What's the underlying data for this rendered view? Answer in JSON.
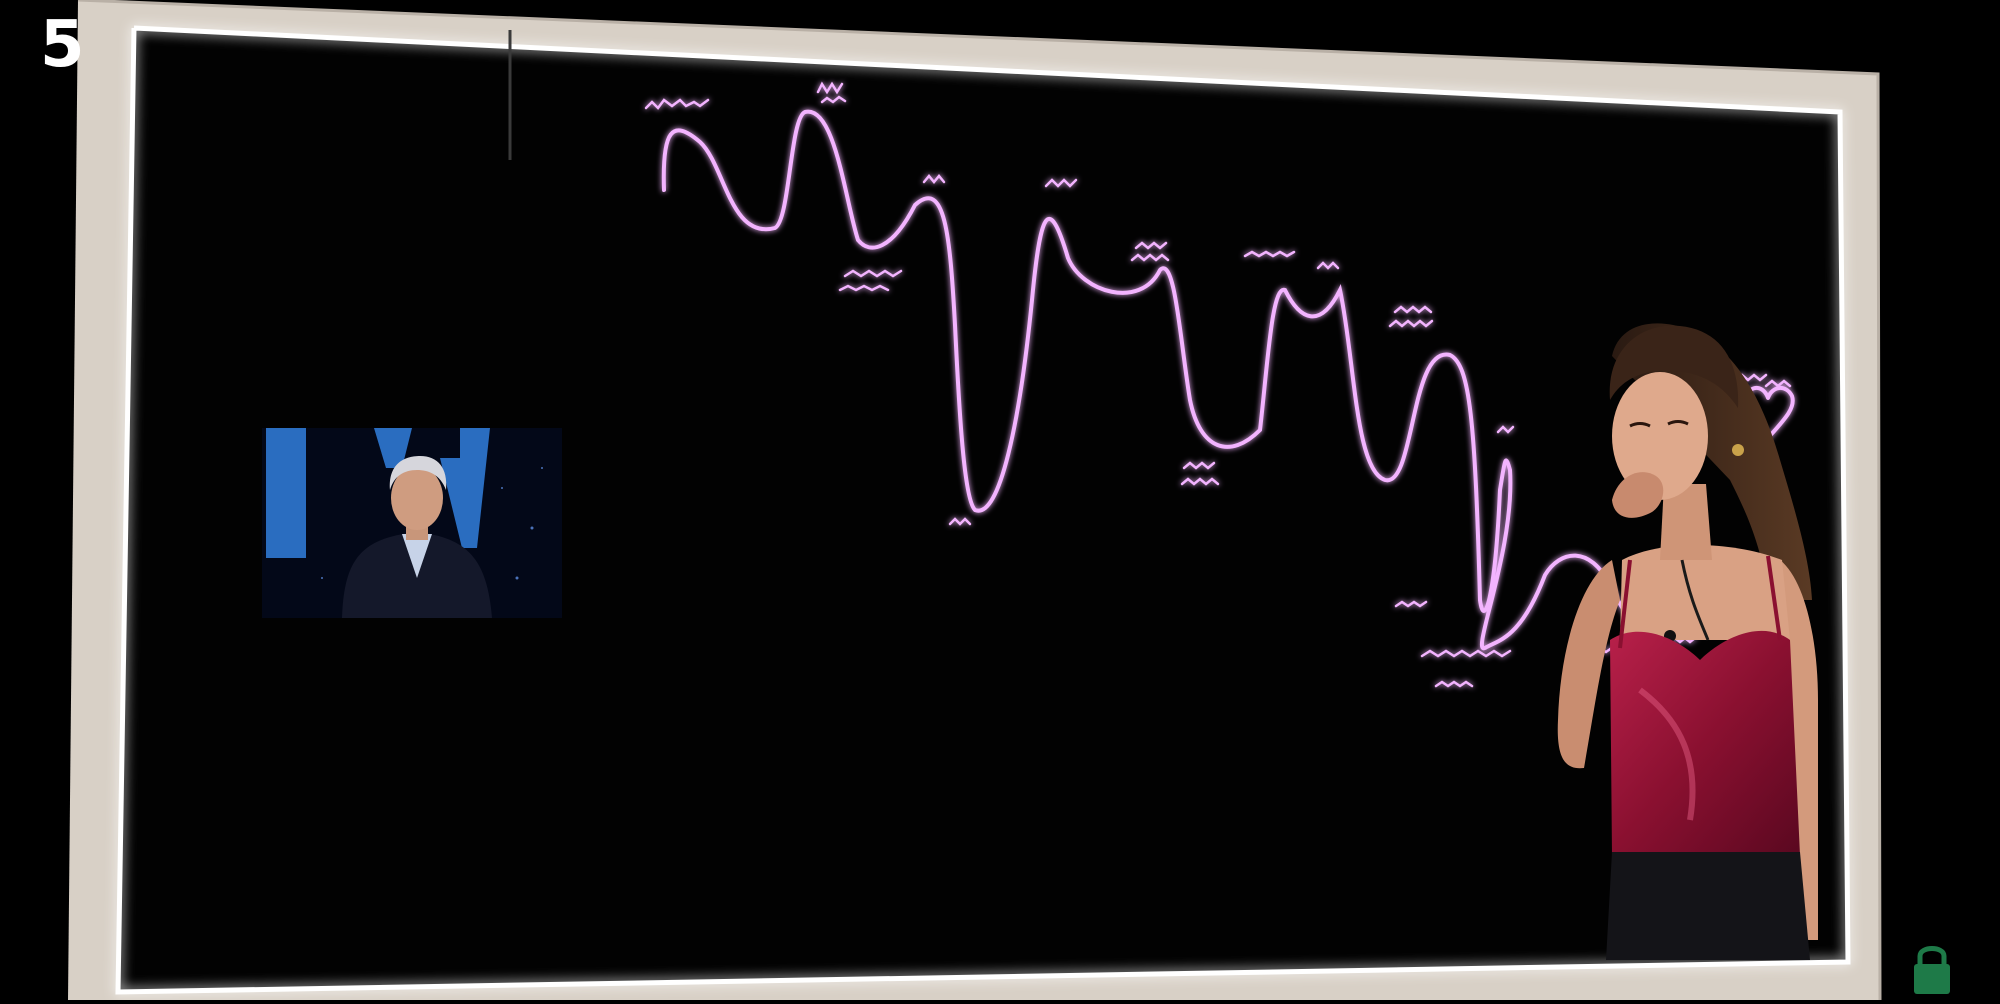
{
  "broadcast": {
    "channel_logo": "5",
    "corner_icon": "lock-icon"
  },
  "colors": {
    "board_frame": "#e7dfd6",
    "board_background": "#020202",
    "marker": "#f3b4ff",
    "marker_glow": "#d860ff",
    "dress": "#8a1030",
    "skin": "#d9a184",
    "inset_screen_blue": "#2a6dc0"
  },
  "board": {
    "icons": [
      "heart-icon"
    ]
  }
}
